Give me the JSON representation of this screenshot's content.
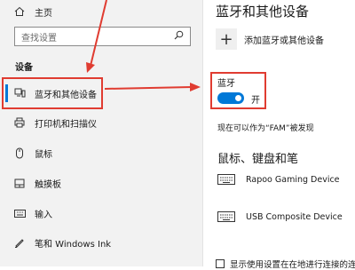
{
  "sidebar": {
    "home_label": "主页",
    "search_placeholder": "查找设置",
    "section_label": "设备",
    "items": [
      {
        "label": "蓝牙和其他设备",
        "icon": "bluetooth-devices-icon",
        "selected": true
      },
      {
        "label": "打印机和扫描仪",
        "icon": "printer-icon"
      },
      {
        "label": "鼠标",
        "icon": "mouse-icon"
      },
      {
        "label": "触摸板",
        "icon": "touchpad-icon"
      },
      {
        "label": "输入",
        "icon": "keyboard-icon"
      },
      {
        "label": "笔和 Windows Ink",
        "icon": "pen-icon"
      }
    ]
  },
  "main": {
    "title": "蓝牙和其他设备",
    "add_device_label": "添加蓝牙或其他设备",
    "bluetooth_label": "蓝牙",
    "toggle_state": "开",
    "toggle_on": true,
    "discoverable_text": "现在可以作为“FAM”被发现",
    "section_title": "鼠标、键盘和笔",
    "devices": [
      {
        "name": "Rapoo Gaming Device",
        "icon": "keyboard-icon"
      },
      {
        "name": "USB Composite Device",
        "icon": "keyboard-icon"
      }
    ],
    "cut_off_text": "显示使用设置在在地进行连接的连接"
  },
  "colors": {
    "accent": "#0078d7",
    "highlight": "#e03c31"
  }
}
